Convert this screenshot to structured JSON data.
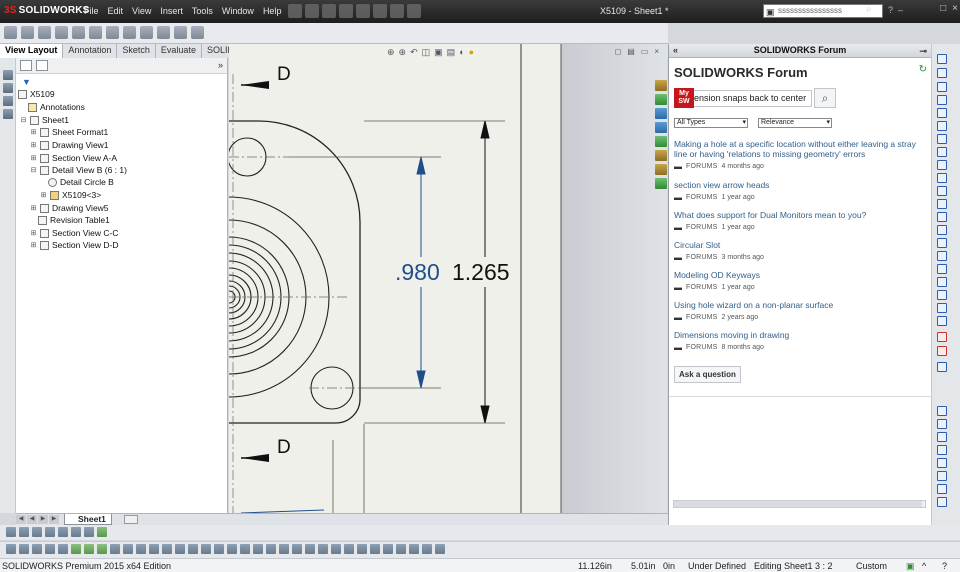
{
  "app": {
    "logo": "SOLIDWORKS",
    "menu": [
      "File",
      "Edit",
      "View",
      "Insert",
      "Tools",
      "Window",
      "Help"
    ],
    "doc_title": "X5109 - Sheet1 *",
    "search_placeholder": "ssssssssssssssss",
    "edition": "SOLIDWORKS Premium 2015 x64 Edition"
  },
  "command_tabs": [
    "View Layout",
    "Annotation",
    "Sketch",
    "Evaluate",
    "SOLIDWORKS Add-Ins"
  ],
  "tree": {
    "root": "X5109",
    "annotations": "Annotations",
    "sheet": "Sheet1",
    "items": [
      "Sheet Format1",
      "Drawing View1",
      "Section View A-A",
      "Detail View B (6 : 1)",
      "Detail Circle B",
      "X5109<3>",
      "Drawing View5",
      "Revision Table1",
      "Section View C-C",
      "Section View D-D"
    ]
  },
  "drawing": {
    "section_label_top": "D",
    "section_label_bottom": "D",
    "dim_inner": ".980",
    "dim_outer": "1.265",
    "dim_color": "#1f4e8a"
  },
  "sheet_tab": "Sheet1",
  "task_pane": {
    "header": "SOLIDWORKS Forum",
    "title": "SOLIDWORKS Forum",
    "mysw": "My SW",
    "search_value": "ension snaps back to center",
    "filter_type": "All Types",
    "filter_sort": "Relevance",
    "posts": [
      {
        "title": "Making a hole at a specific location without either leaving a stray line or having 'relations to missing geometry' errors",
        "category": "FORUMS",
        "time": "4 months ago"
      },
      {
        "title": "section view arrow heads",
        "category": "FORUMS",
        "time": "1 year ago"
      },
      {
        "title": "What does support for Dual Monitors mean to you?",
        "category": "FORUMS",
        "time": "1 year ago"
      },
      {
        "title": "Circular Slot",
        "category": "FORUMS",
        "time": "3 months ago"
      },
      {
        "title": "Modeling OD Keyways",
        "category": "FORUMS",
        "time": "1 year ago"
      },
      {
        "title": "Using hole wizard on a non-planar surface",
        "category": "FORUMS",
        "time": "2 years ago"
      },
      {
        "title": "Dimensions moving in drawing",
        "category": "FORUMS",
        "time": "8 months ago"
      }
    ],
    "ask_button": "Ask a question"
  },
  "status": {
    "x": "11.126in",
    "y": "5.01in",
    "z": "0in",
    "state": "Under Defined",
    "editing": "Editing Sheet1",
    "scale": "3 : 2",
    "units": "Custom"
  }
}
